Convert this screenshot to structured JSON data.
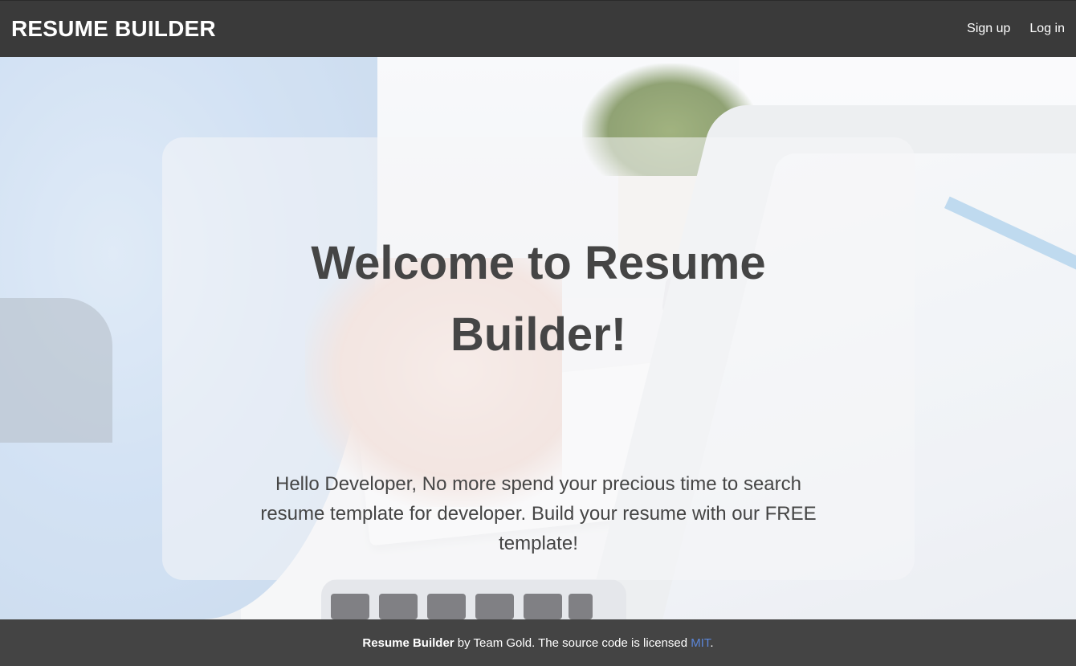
{
  "header": {
    "brand": "RESUME BUILDER",
    "links": [
      {
        "label": "Sign up"
      },
      {
        "label": "Log in"
      }
    ]
  },
  "hero": {
    "title": "Welcome to Resume Builder!",
    "text": "Hello Developer, No more spend your precious time to search resume template for developer. Build your resume with our FREE template!"
  },
  "footer": {
    "project": "Resume Builder",
    "by": " by Team Gold. The source code is licensed ",
    "license_label": "MIT",
    "end": "."
  },
  "colors": {
    "navbar_bg": "#3a3a3a",
    "footer_bg": "#444444",
    "link_blue": "#5b86d8",
    "text_dark": "#454545"
  }
}
